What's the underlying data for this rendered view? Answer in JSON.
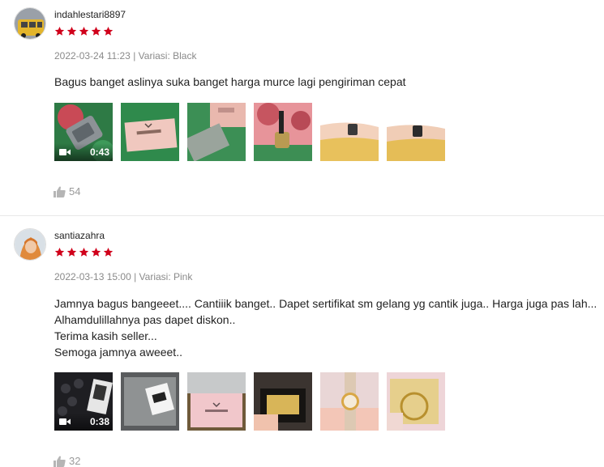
{
  "reviews": [
    {
      "username": "indahlestari8897",
      "rating": 5,
      "date_time": "2022-03-24 11:23",
      "variation_label": "Variasi: Black",
      "comment_lines": [
        "Bagus banget aslinya suka banget harga murce lagi pengiriman cepat"
      ],
      "video_duration": "0:43",
      "likes": "54"
    },
    {
      "username": "santiazahra",
      "rating": 5,
      "date_time": "2022-03-13 15:00",
      "variation_label": "Variasi: Pink",
      "comment_lines": [
        "Jamnya bagus bangeeet.... Cantiiik banget.. Dapet sertifikat sm gelang yg cantik juga.. Harga juga pas lah...",
        "Alhamdulillahnya pas dapet diskon..",
        "Terima kasih seller...",
        "Semoga jamnya aweeet.."
      ],
      "video_duration": "0:38",
      "likes": "32"
    }
  ],
  "separator": " | ",
  "colors": {
    "star": "#d0011b",
    "meta": "#8a8a8a",
    "like": "#9a9a9a"
  },
  "icons": {
    "star": "star-icon",
    "video": "video-camera-icon",
    "like": "thumbs-up-icon"
  }
}
